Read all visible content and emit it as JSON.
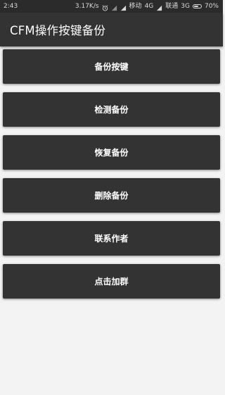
{
  "status_bar": {
    "time": "2:43",
    "speed": "3.17K/s",
    "carrier1": "移动",
    "network1": "4G",
    "carrier2": "联通",
    "network2": "3G",
    "battery_text": "70%",
    "battery_level": 0.7,
    "icons": [
      "alarm-icon",
      "muted-signal-icon",
      "signal-bars-icon",
      "battery-icon"
    ]
  },
  "toolbar": {
    "title": "CFM操作按键备份"
  },
  "buttons": [
    {
      "label": "备份按键"
    },
    {
      "label": "检测备份"
    },
    {
      "label": "恢复备份"
    },
    {
      "label": "删除备份"
    },
    {
      "label": "联系作者"
    },
    {
      "label": "点击加群"
    }
  ],
  "colors": {
    "toolbar_bg": "#333333",
    "status_bg": "#2b2b2b",
    "button_bg": "#333333",
    "page_bg": "#f3f3f3",
    "text": "#ffffff"
  }
}
